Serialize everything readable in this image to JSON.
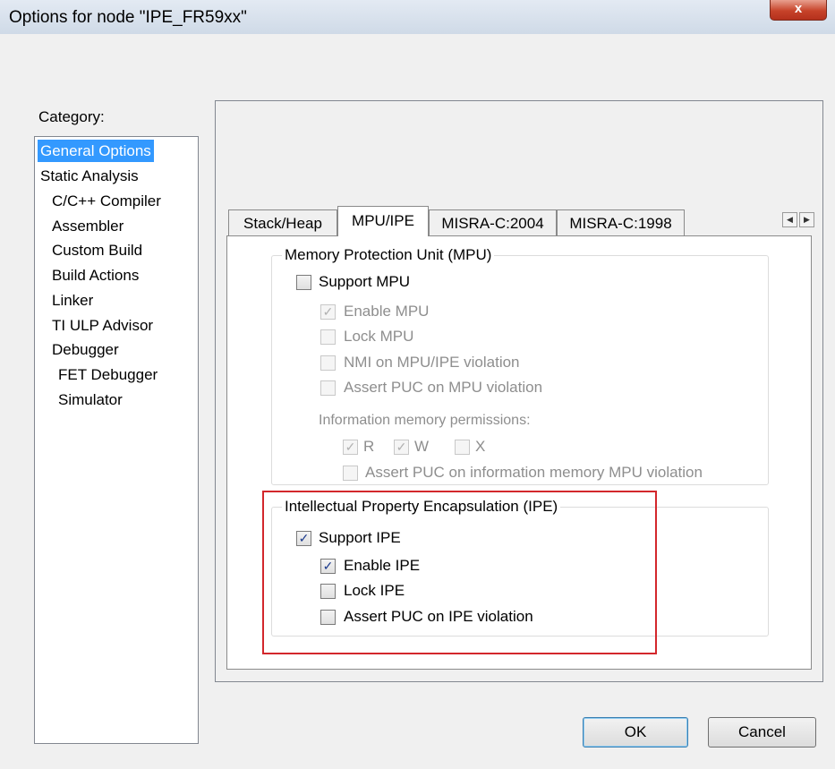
{
  "window": {
    "title": "Options for node \"IPE_FR59xx\"",
    "close_label": "x"
  },
  "category": {
    "label": "Category:",
    "items": [
      {
        "label": "General Options"
      },
      {
        "label": "Static Analysis"
      },
      {
        "label": "C/C++ Compiler"
      },
      {
        "label": "Assembler"
      },
      {
        "label": "Custom Build"
      },
      {
        "label": "Build Actions"
      },
      {
        "label": "Linker"
      },
      {
        "label": "TI ULP Advisor"
      },
      {
        "label": "Debugger"
      },
      {
        "label": "FET Debugger"
      },
      {
        "label": "Simulator"
      }
    ],
    "selected": "General Options"
  },
  "tabs": [
    {
      "label": "Stack/Heap"
    },
    {
      "label": "MPU/IPE"
    },
    {
      "label": "MISRA-C:2004"
    },
    {
      "label": "MISRA-C:1998"
    }
  ],
  "active_tab": "MPU/IPE",
  "mpu": {
    "legend": "Memory Protection Unit (MPU)",
    "support": {
      "label": "Support MPU",
      "checked": false
    },
    "options": [
      {
        "label": "Enable MPU",
        "checked": true
      },
      {
        "label": "Lock MPU",
        "checked": false
      },
      {
        "label": "NMI on MPU/IPE violation",
        "checked": false
      },
      {
        "label": "Assert PUC on MPU violation",
        "checked": false
      }
    ],
    "info_label": "Information memory permissions:",
    "perms": [
      {
        "label": "R",
        "checked": true
      },
      {
        "label": "W",
        "checked": true
      },
      {
        "label": "X",
        "checked": false
      }
    ],
    "info_assert": {
      "label": "Assert PUC on information memory MPU violation",
      "checked": false
    }
  },
  "ipe": {
    "legend": "Intellectual Property Encapsulation (IPE)",
    "support": {
      "label": "Support IPE",
      "checked": true
    },
    "options": [
      {
        "label": "Enable IPE",
        "checked": true
      },
      {
        "label": "Lock IPE",
        "checked": false
      },
      {
        "label": "Assert PUC on IPE violation",
        "checked": false
      }
    ]
  },
  "buttons": {
    "ok": "OK",
    "cancel": "Cancel"
  },
  "icons": {
    "check": "✓",
    "scroll_left": "◀",
    "scroll_right": "▶"
  },
  "colors": {
    "selection": "#3399ff",
    "highlight_box": "#d3272c",
    "close_button": "#c7432a"
  }
}
